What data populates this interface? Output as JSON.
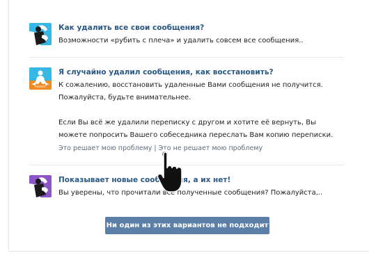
{
  "faq": {
    "items": [
      {
        "title": "Как удалить все свои сообщения?",
        "text": "Возможности «рубить с плеча» и удалить совсем все сообщения..",
        "icon": "phone-person-icon"
      },
      {
        "title": "Я случайно удалил сообщения, как восстановить?",
        "text_p1_line1": "К сожалению, восстановить удаленные Вами сообщения не получится.",
        "text_p1_line2": "Пожалуйста, будьте внимательнее.",
        "text_p2_line1": "Если Вы всё же удалили переписку с другом и хотите её вернуть, Вы",
        "text_p2_line2": "можете попросить Вашего собеседника переслать Вам копию переписки.",
        "helpful": "Это решает мою проблему",
        "separator": "|",
        "not_helpful": "Это не решает мою проблему",
        "icon": "meditating-person-icon"
      },
      {
        "title": "Показывает новые сообщения, а их нет!",
        "text": "Вы уверены, что прочитали все полученные сообщения? Пожалуйста,..",
        "icon": "phone-person-icon"
      }
    ],
    "none_button": "Ни один из этих вариантов не подходит"
  },
  "colors": {
    "title": "#2a5885",
    "button": "#5b7fa6",
    "icon_blue": "#36b7e6",
    "icon_orange": "#f08b24",
    "icon_purple": "#8b55c8"
  }
}
